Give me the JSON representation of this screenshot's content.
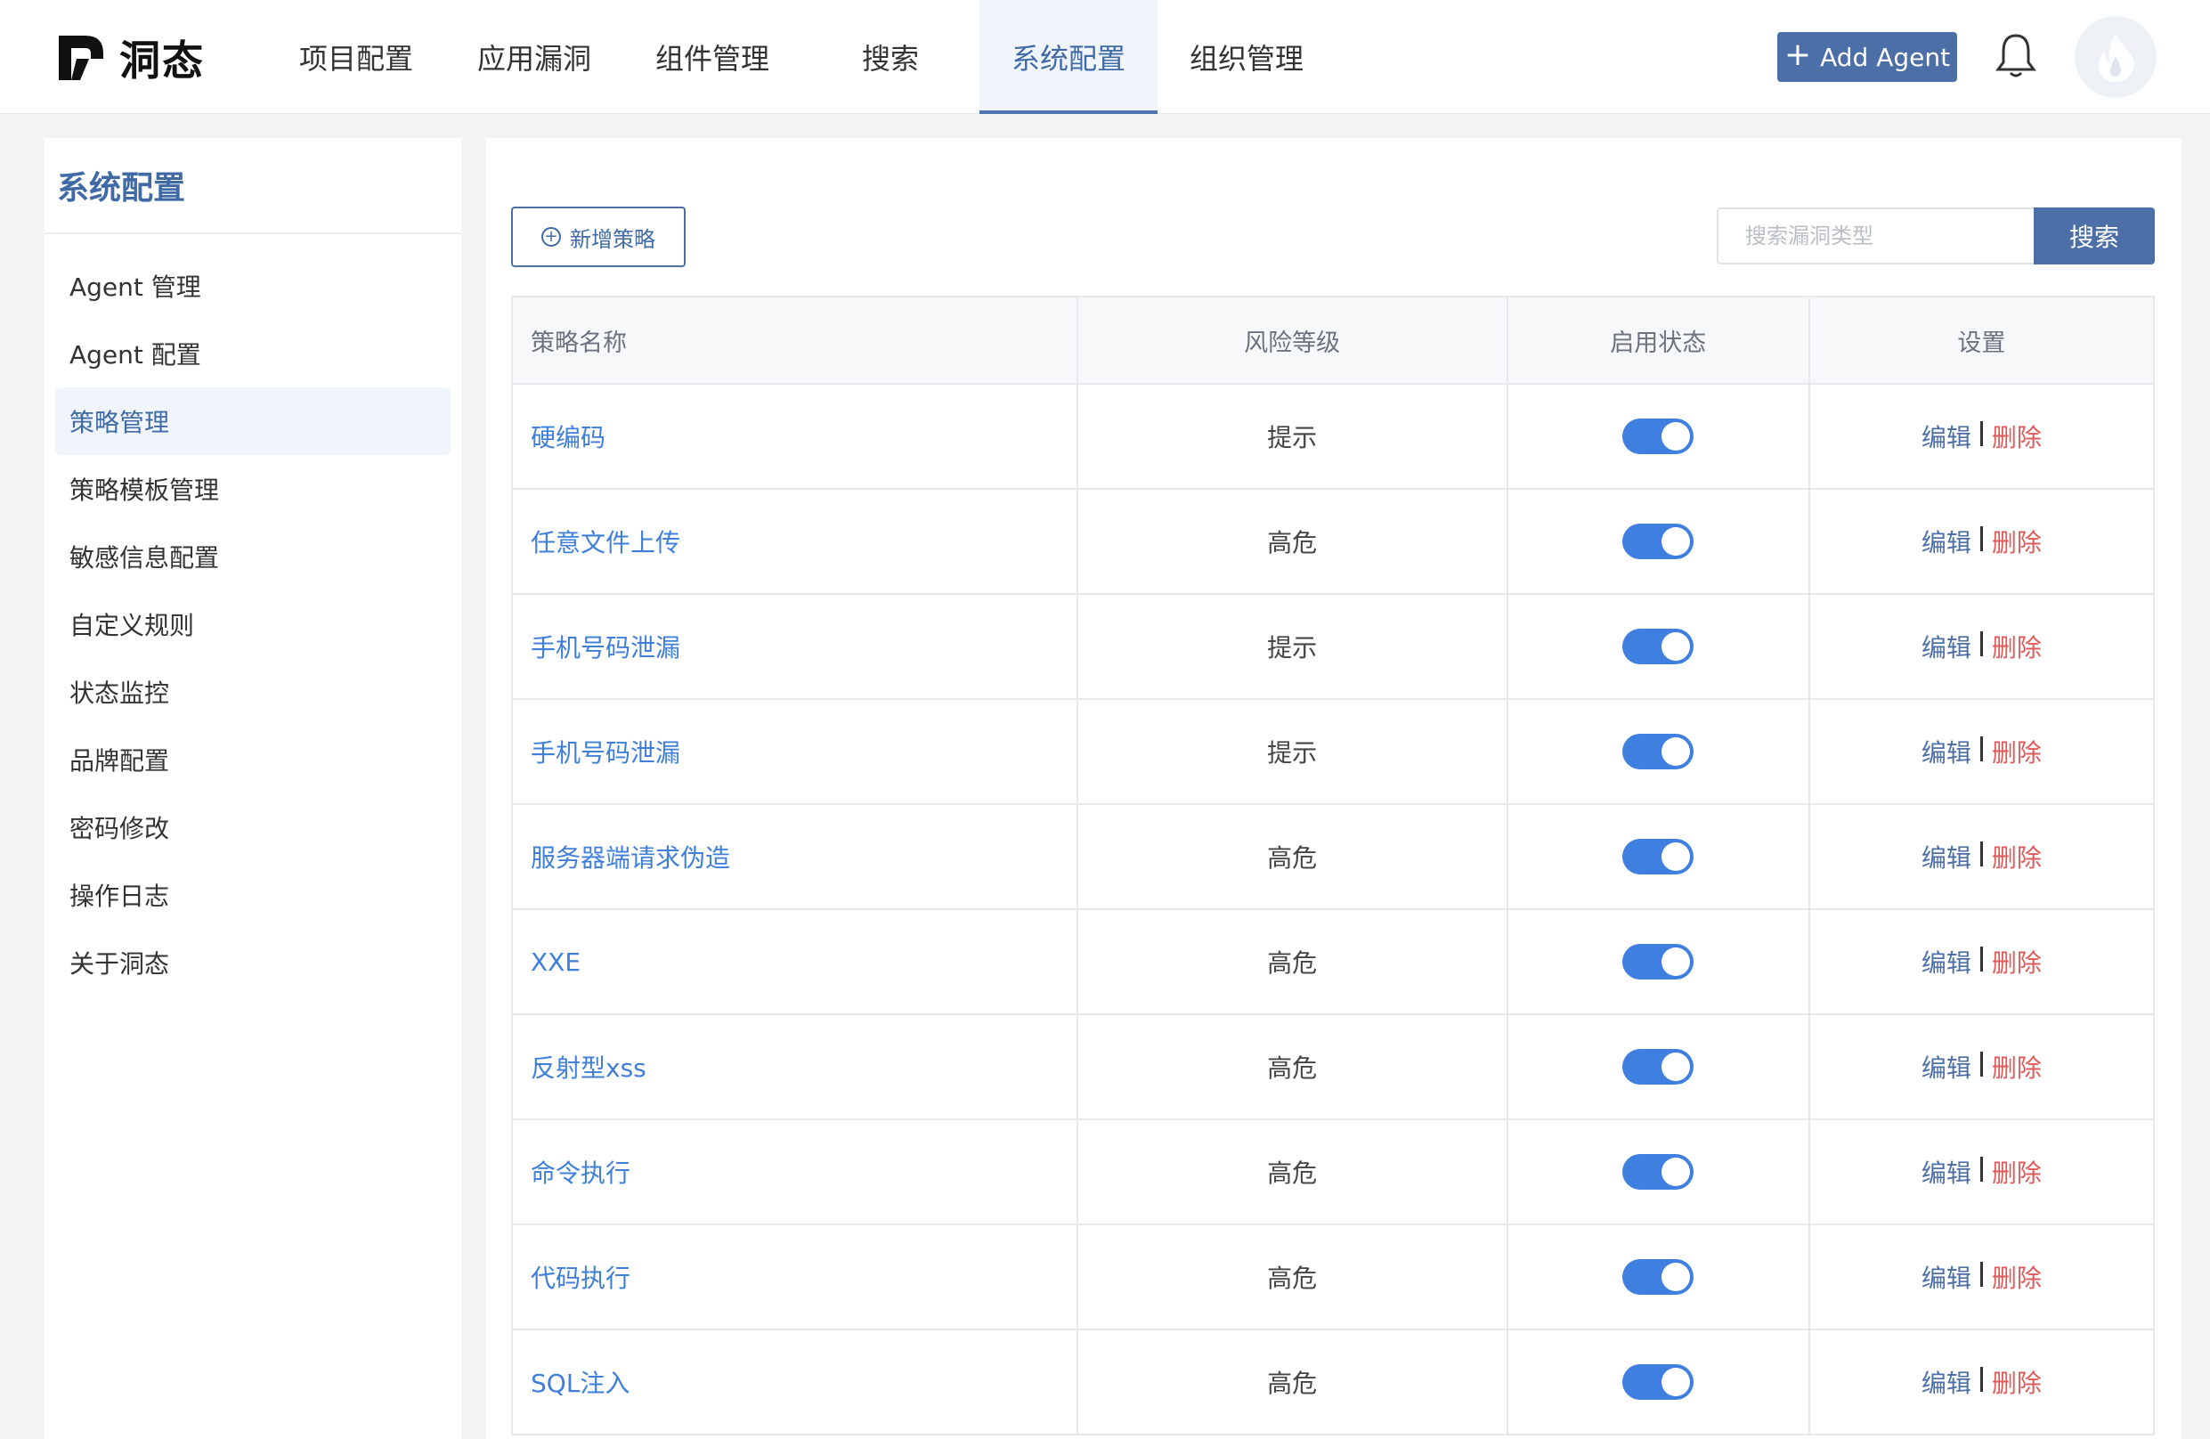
{
  "brand": {
    "name": "洞态"
  },
  "nav": {
    "items": [
      {
        "label": "项目配置"
      },
      {
        "label": "应用漏洞"
      },
      {
        "label": "组件管理"
      },
      {
        "label": "搜索"
      },
      {
        "label": "系统配置",
        "active": true
      },
      {
        "label": "组织管理"
      }
    ]
  },
  "header": {
    "add_agent_label": "Add Agent"
  },
  "sidebar": {
    "title": "系统配置",
    "items": [
      {
        "label": "Agent 管理"
      },
      {
        "label": "Agent 配置"
      },
      {
        "label": "策略管理",
        "active": true
      },
      {
        "label": "策略模板管理"
      },
      {
        "label": "敏感信息配置"
      },
      {
        "label": "自定义规则"
      },
      {
        "label": "状态监控"
      },
      {
        "label": "品牌配置"
      },
      {
        "label": "密码修改"
      },
      {
        "label": "操作日志"
      },
      {
        "label": "关于洞态"
      }
    ]
  },
  "toolbar": {
    "new_label": "新增策略",
    "search_placeholder": "搜索漏洞类型",
    "search_label": "搜索"
  },
  "table": {
    "headers": [
      "策略名称",
      "风险等级",
      "启用状态",
      "设置"
    ],
    "edit_label": "编辑",
    "delete_label": "删除",
    "rows": [
      {
        "name": "硬编码",
        "risk": "提示",
        "enabled": true
      },
      {
        "name": "任意文件上传",
        "risk": "高危",
        "enabled": true
      },
      {
        "name": "手机号码泄漏",
        "risk": "提示",
        "enabled": true
      },
      {
        "name": "手机号码泄漏",
        "risk": "提示",
        "enabled": true
      },
      {
        "name": "服务器端请求伪造",
        "risk": "高危",
        "enabled": true
      },
      {
        "name": "XXE",
        "risk": "高危",
        "enabled": true
      },
      {
        "name": "反射型xss",
        "risk": "高危",
        "enabled": true
      },
      {
        "name": "命令执行",
        "risk": "高危",
        "enabled": true
      },
      {
        "name": "代码执行",
        "risk": "高危",
        "enabled": true
      },
      {
        "name": "SQL注入",
        "risk": "高危",
        "enabled": true
      }
    ]
  },
  "colors": {
    "accent": "#4d6fa8",
    "link": "#3f7fd9",
    "danger": "#e05a5a",
    "toggle_on": "#3e7fe0"
  },
  "icons": {
    "logo": "dongtai-logo-icon",
    "bell": "bell-icon",
    "avatar": "flame-avatar-icon",
    "plus": "plus-icon",
    "circle_plus": "circle-plus-icon"
  }
}
